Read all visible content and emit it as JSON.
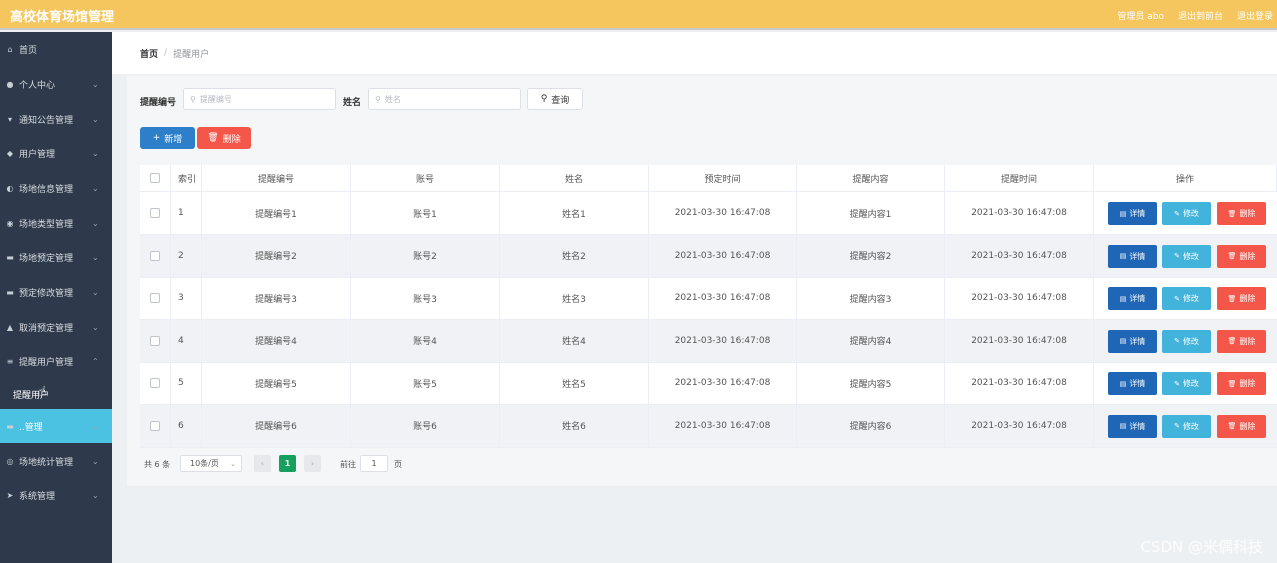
{
  "app": {
    "title": "高校体育场馆管理"
  },
  "header": {
    "admin": "管理员 abo",
    "back_to_home": "退出到前台",
    "logout": "退出登录"
  },
  "sidebar": {
    "items": [
      {
        "label": "首页",
        "icon": "home-icon",
        "expandable": false
      },
      {
        "label": "个人中心",
        "icon": "user-icon",
        "expandable": true
      },
      {
        "label": "通知公告管理",
        "icon": "notice-icon",
        "expandable": true
      },
      {
        "label": "用户管理",
        "icon": "users-icon",
        "expandable": true
      },
      {
        "label": "场地信息管理",
        "icon": "venue-icon",
        "expandable": true
      },
      {
        "label": "场地类型管理",
        "icon": "type-icon",
        "expandable": true
      },
      {
        "label": "场地预定管理",
        "icon": "booking-icon",
        "expandable": true
      },
      {
        "label": "预定修改管理",
        "icon": "edit-booking-icon",
        "expandable": true
      },
      {
        "label": "取消预定管理",
        "icon": "cancel-icon",
        "expandable": true
      },
      {
        "label": "提醒用户管理",
        "icon": "list-icon",
        "expandable": true,
        "expanded": true
      },
      {
        "label": "提醒用户",
        "sub": true
      },
      {
        "label": "..管理",
        "icon": "message-icon",
        "expandable": true,
        "active": true
      },
      {
        "label": "场地统计管理",
        "icon": "stats-icon",
        "expandable": true
      },
      {
        "label": "系统管理",
        "icon": "system-icon",
        "expandable": true
      }
    ]
  },
  "breadcrumb": {
    "home": "首页",
    "separator": "/",
    "current": "提醒用户"
  },
  "search": {
    "remind_no_label": "提醒编号",
    "remind_no_placeholder": "提醒编号",
    "name_label": "姓名",
    "name_placeholder": "姓名",
    "query_button": "查询"
  },
  "actions": {
    "add": "新增",
    "delete": "删除"
  },
  "table": {
    "columns": [
      "索引",
      "提醒编号",
      "账号",
      "姓名",
      "预定时间",
      "提醒内容",
      "提醒时间",
      "操作"
    ],
    "rows": [
      {
        "index": "1",
        "remind_no": "提醒编号1",
        "account": "账号1",
        "name": "姓名1",
        "booking_time": "2021-03-30 16:47:08",
        "content": "提醒内容1",
        "remind_time": "2021-03-30 16:47:08"
      },
      {
        "index": "2",
        "remind_no": "提醒编号2",
        "account": "账号2",
        "name": "姓名2",
        "booking_time": "2021-03-30 16:47:08",
        "content": "提醒内容2",
        "remind_time": "2021-03-30 16:47:08"
      },
      {
        "index": "3",
        "remind_no": "提醒编号3",
        "account": "账号3",
        "name": "姓名3",
        "booking_time": "2021-03-30 16:47:08",
        "content": "提醒内容3",
        "remind_time": "2021-03-30 16:47:08"
      },
      {
        "index": "4",
        "remind_no": "提醒编号4",
        "account": "账号4",
        "name": "姓名4",
        "booking_time": "2021-03-30 16:47:08",
        "content": "提醒内容4",
        "remind_time": "2021-03-30 16:47:08"
      },
      {
        "index": "5",
        "remind_no": "提醒编号5",
        "account": "账号5",
        "name": "姓名5",
        "booking_time": "2021-03-30 16:47:08",
        "content": "提醒内容5",
        "remind_time": "2021-03-30 16:47:08"
      },
      {
        "index": "6",
        "remind_no": "提醒编号6",
        "account": "账号6",
        "name": "姓名6",
        "booking_time": "2021-03-30 16:47:08",
        "content": "提醒内容6",
        "remind_time": "2021-03-30 16:47:08"
      }
    ],
    "row_actions": {
      "detail": "详情",
      "edit": "修改",
      "delete": "删除"
    }
  },
  "pagination": {
    "total": "共 6 条",
    "page_size": "10条/页",
    "current_page": "1",
    "goto_label": "前往",
    "goto_value": "1",
    "goto_unit": "页"
  },
  "watermark": "CSDN @米偶科技",
  "colors": {
    "header_bg": "#f4c65d",
    "sidebar_bg": "#2e3a4b",
    "sidebar_active": "#4cc2e3",
    "primary": "#2d7fc9",
    "danger": "#f4574a",
    "info": "#42b3da",
    "success": "#17a05d"
  }
}
